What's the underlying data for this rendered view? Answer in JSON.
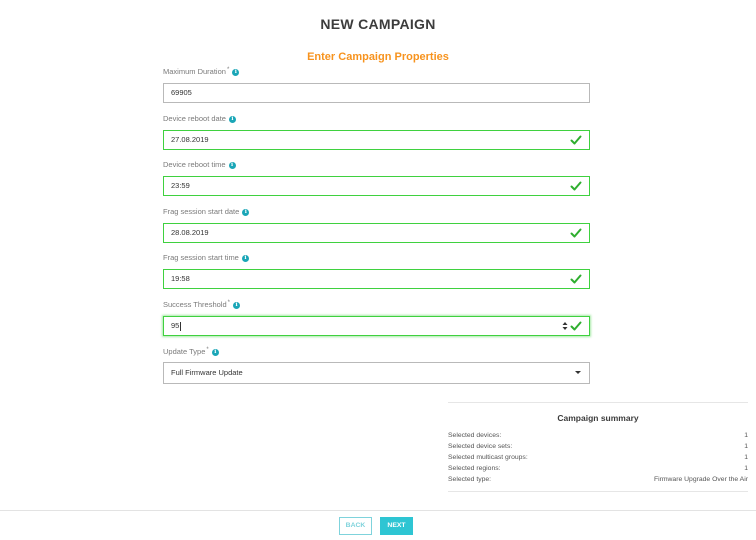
{
  "page": {
    "title": "NEW CAMPAIGN",
    "section_title": "Enter Campaign Properties"
  },
  "fields": [
    {
      "label": "Maximum Duration",
      "required": true,
      "value": "69905",
      "state": "normal"
    },
    {
      "label": "Device reboot date",
      "required": false,
      "value": "27.08.2019",
      "state": "valid"
    },
    {
      "label": "Device reboot time",
      "required": false,
      "value": "23:59",
      "state": "valid"
    },
    {
      "label": "Frag session start date",
      "required": false,
      "value": "28.08.2019",
      "state": "valid"
    },
    {
      "label": "Frag session start time",
      "required": false,
      "value": "19:58",
      "state": "valid"
    },
    {
      "label": "Success Threshold",
      "required": true,
      "value": "95",
      "state": "valid-focused"
    },
    {
      "label": "Update Type",
      "required": true,
      "value": "Full Firmware Update",
      "state": "select"
    }
  ],
  "required_mark": "*",
  "info_glyph": "i",
  "summary": {
    "title": "Campaign summary",
    "rows": [
      {
        "label": "Selected devices:",
        "value": "1"
      },
      {
        "label": "Selected device sets:",
        "value": "1"
      },
      {
        "label": "Selected multicast groups:",
        "value": "1"
      },
      {
        "label": "Selected regions:",
        "value": "1"
      },
      {
        "label": "Selected type:",
        "value": "Firmware Upgrade Over the Air"
      }
    ]
  },
  "buttons": {
    "back": "BACK",
    "next": "NEXT"
  },
  "colors": {
    "accent_orange": "#f7931e",
    "valid_green": "#3fd13f",
    "teal": "#2ec5d3",
    "info_icon": "#1aa6b7"
  },
  "icons": {
    "info": "info-icon",
    "valid": "check-icon",
    "spinner": "spinner-arrows-icon",
    "dropdown": "chevron-down-icon"
  }
}
